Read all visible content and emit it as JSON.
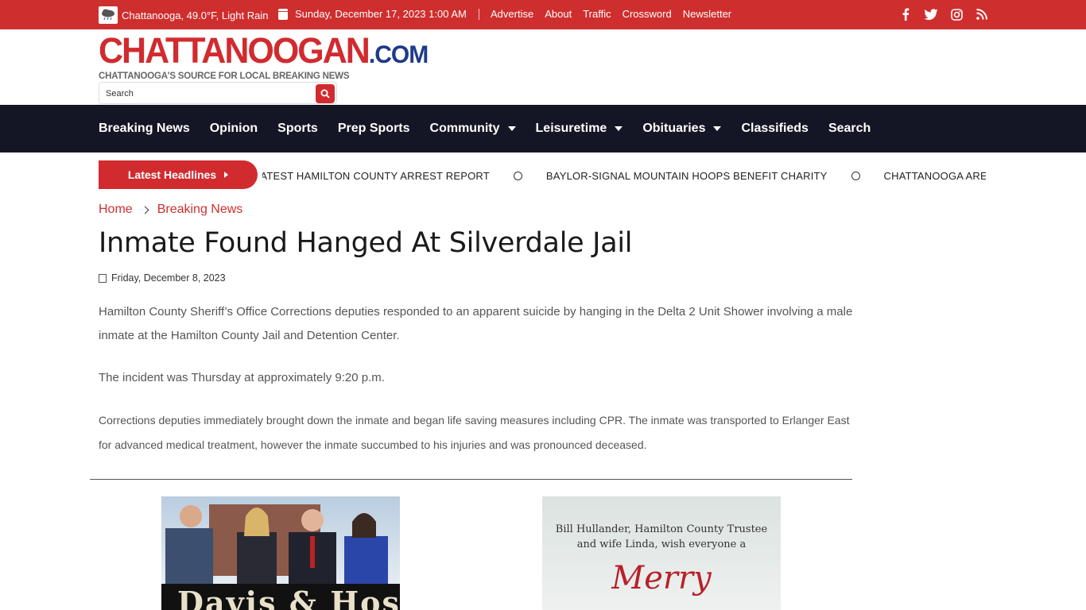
{
  "topbar": {
    "weather": "Chattanooga, 49.0°F, Light Rain",
    "date": "Sunday, December 17, 2023 1:00 AM",
    "links": [
      "Advertise",
      "About",
      "Traffic",
      "Crossword",
      "Newsletter"
    ],
    "social_icons": [
      "facebook-icon",
      "twitter-icon",
      "instagram-icon",
      "rss-icon"
    ]
  },
  "header": {
    "logo_main": "CHATTANOOGAN",
    "logo_suffix": ".COM",
    "tagline": "CHATTANOOGA'S SOURCE FOR LOCAL BREAKING NEWS",
    "search_placeholder": "Search"
  },
  "nav": {
    "items": [
      "Breaking News",
      "Opinion",
      "Sports",
      "Prep Sports",
      "Community",
      "Leisuretime",
      "Obituaries",
      "Classifieds",
      "Search"
    ]
  },
  "ticker": {
    "button_label": "Latest Headlines",
    "items": [
      "LATEST HAMILTON COUNTY ARREST REPORT",
      "BAYLOR-SIGNAL MOUNTAIN HOOPS BENEFIT CHARITY",
      "CHATTANOOGA AREA GOLF PRO"
    ]
  },
  "breadcrumb": {
    "home": "Home",
    "section": "Breaking News"
  },
  "article": {
    "title": "Inmate Found Hanged At Silverdale Jail",
    "date": "Friday, December 8, 2023",
    "paragraphs": [
      "Hamilton County Sheriff’s Office Corrections deputies responded to an apparent suicide by hanging in the Delta 2 Unit Shower involving a male inmate at the Hamilton County Jail and Detention Center.",
      "The incident was Thursday at approximately 9:20 p.m.",
      "Corrections deputies immediately brought down the inmate and began life saving measures including CPR. The inmate was transported to Erlanger East for advanced medical treatment, however the inmate succumbed to his injuries and was pronounced deceased."
    ]
  },
  "ads": {
    "ad1_banner": "Davis & Hoss",
    "ad2_line1": "Bill Hullander, Hamilton County Trustee",
    "ad2_line2": "and wife Linda, wish everyone a",
    "ad2_script": "Merry"
  },
  "colors": {
    "brand_red": "#cf2e2e",
    "nav_bg": "#141625",
    "logo_blue": "#1e3a8a"
  }
}
